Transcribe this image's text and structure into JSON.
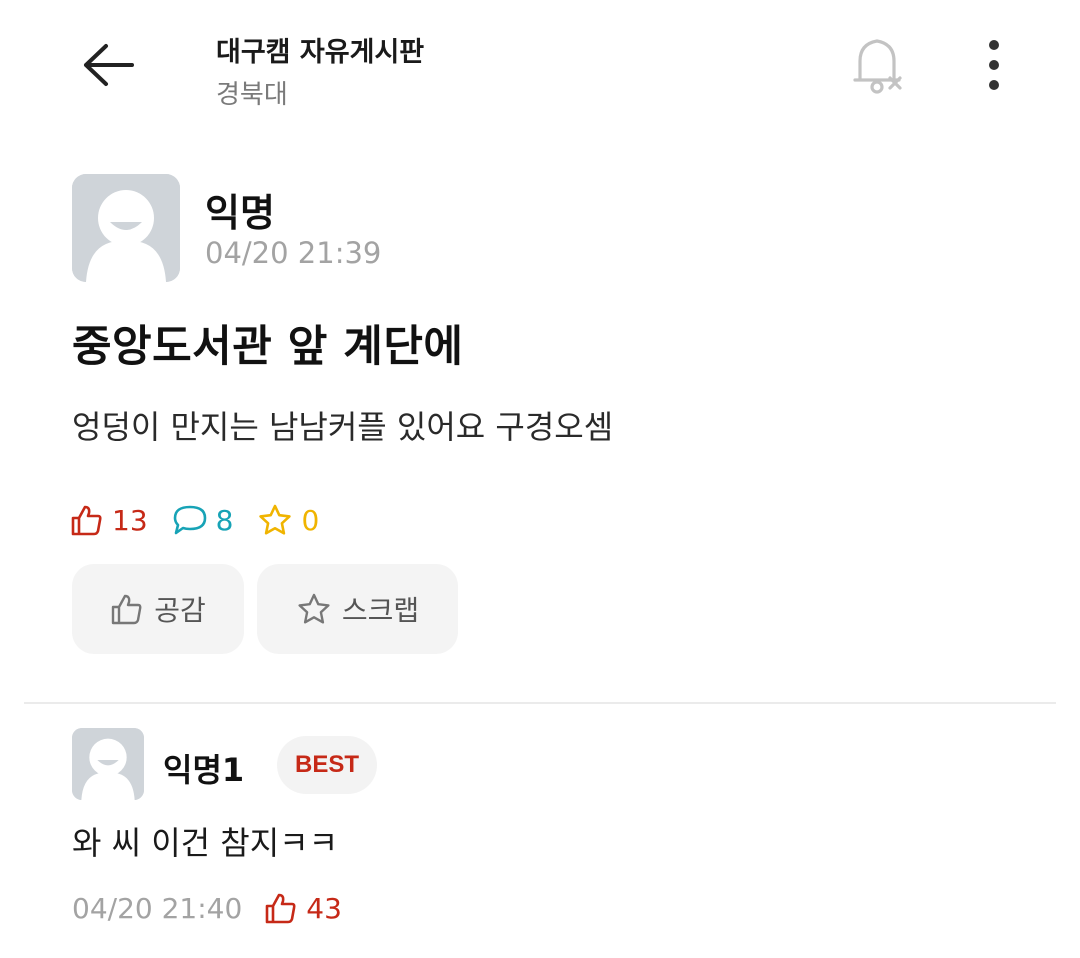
{
  "header": {
    "title": "대구캠 자유게시판",
    "subtitle": "경북대",
    "icons": {
      "back": "arrow-left-icon",
      "notification": "bell-off-icon",
      "more": "more-vertical-icon"
    }
  },
  "post": {
    "author": "익명",
    "time": "04/20 21:39",
    "title": "중앙도서관 앞 계단에",
    "body": "엉덩이 만지는 남남커플 있어요 구경오셈",
    "stats": {
      "likes": "13",
      "comments": "8",
      "scraps": "0"
    },
    "actions": {
      "like_label": "공감",
      "scrap_label": "스크랩"
    }
  },
  "comments": [
    {
      "author": "익명1",
      "badge": "BEST",
      "text": "와 씨 이건 참지ㅋㅋ",
      "time": "04/20 21:40",
      "likes": "43"
    }
  ],
  "colors": {
    "like": "#c62917",
    "comment": "#17a3b6",
    "scrap": "#f0b400",
    "muted": "#a3a3a3",
    "avatar_bg": "#cfd4d9",
    "button_bg": "#f4f4f4"
  }
}
